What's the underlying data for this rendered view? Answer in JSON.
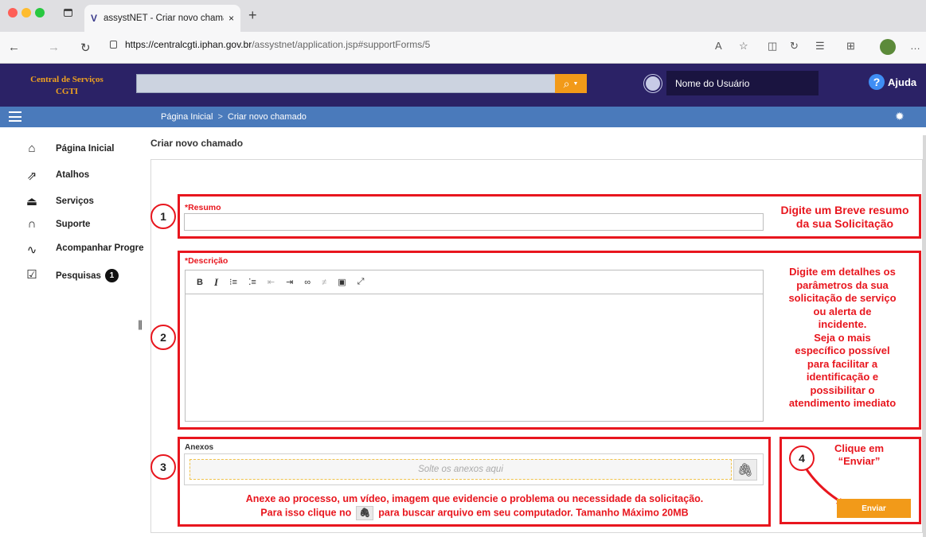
{
  "browser": {
    "tab_title": "assystNET - Criar novo chama",
    "tab_close": "×",
    "new_tab": "+",
    "url_domain": "https://centralcgti.iphan.gov.br",
    "url_path": "/assystnet/application.jsp#supportForms/5"
  },
  "header": {
    "brand_line1": "Central de Serviços",
    "brand_line2": "CGTI",
    "search_icon": "search-icon",
    "user_name": "Nome do Usuário",
    "help_label": "Ajuda",
    "help_glyph": "?"
  },
  "breadcrumb": {
    "home": "Página Inicial",
    "separator": ">",
    "current": "Criar novo chamado"
  },
  "sidebar": {
    "items": [
      {
        "label": "Página Inicial",
        "icon": "home-icon"
      },
      {
        "label": "Atalhos",
        "icon": "shortcut-icon"
      },
      {
        "label": "Serviços",
        "icon": "service-bell-icon"
      },
      {
        "label": "Suporte",
        "icon": "headset-icon"
      },
      {
        "label": "Acompanhar Progre",
        "icon": "progress-icon"
      },
      {
        "label": "Pesquisas",
        "icon": "survey-icon",
        "badge": "1"
      }
    ]
  },
  "main": {
    "title": "Criar novo chamado",
    "resumo_label": "*Resumo",
    "descricao_label": "*Descrição",
    "anexos_label": "Anexos",
    "drop_placeholder": "Solte os anexos aqui",
    "send_label": "Enviar"
  },
  "annotations": {
    "n1": "1",
    "n2": "2",
    "n3": "3",
    "n4": "4",
    "hint1_line1": "Digite um Breve resumo",
    "hint1_line2": "da sua Solicitação",
    "hint2_lines": [
      "Digite em detalhes os",
      "parâmetros da sua",
      "solicitação de serviço",
      "ou alerta de",
      "incidente.",
      "Seja o mais",
      "específico possível",
      "para facilitar a",
      "identificação e",
      "possibilitar o",
      "atendimento imediato"
    ],
    "hint3_line1": "Anexe ao processo, um vídeo, imagem que evidencie o problema ou necessidade da solicitação.",
    "hint3_line2a": "Para isso clique no",
    "hint3_line2b": "para buscar arquivo em seu computador. Tamanho Máximo 20MB",
    "hint4_line1": "Clique em",
    "hint4_line2": "“Enviar”"
  },
  "colors": {
    "header_bg": "#2b2266",
    "breadcrumb_bg": "#4a7abb",
    "accent_orange": "#f29a19",
    "annotation_red": "#e8161e"
  }
}
